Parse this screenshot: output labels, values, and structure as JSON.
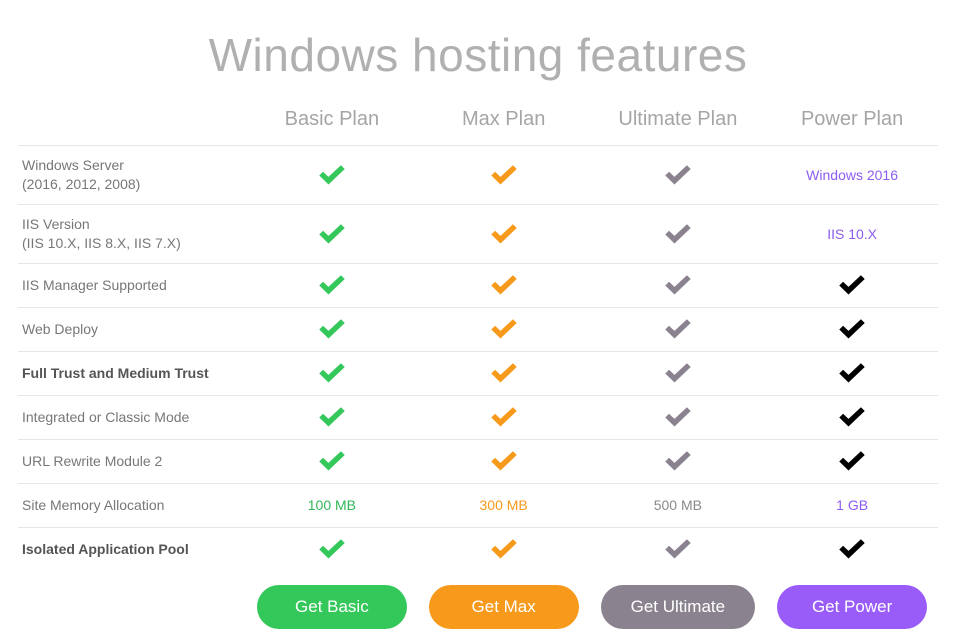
{
  "title": "Windows hosting features",
  "plans": [
    {
      "key": "basic",
      "title": "Basic Plan",
      "button": "Get Basic",
      "style": "green"
    },
    {
      "key": "max",
      "title": "Max Plan",
      "button": "Get Max",
      "style": "orange"
    },
    {
      "key": "ultimate",
      "title": "Ultimate Plan",
      "button": "Get Ultimate",
      "style": "grey"
    },
    {
      "key": "power",
      "title": "Power Plan",
      "button": "Get Power",
      "style": "purple"
    }
  ],
  "features": [
    {
      "label": "Windows Server\n(2016, 2012, 2008)",
      "bold": false,
      "cells": [
        {
          "type": "check"
        },
        {
          "type": "check"
        },
        {
          "type": "check"
        },
        {
          "type": "text",
          "value": "Windows 2016",
          "colorClass": "c-purple"
        }
      ]
    },
    {
      "label": "IIS Version\n(IIS 10.X, IIS 8.X, IIS 7.X)",
      "bold": false,
      "cells": [
        {
          "type": "check"
        },
        {
          "type": "check"
        },
        {
          "type": "check"
        },
        {
          "type": "text",
          "value": "IIS 10.X",
          "colorClass": "c-purple"
        }
      ]
    },
    {
      "label": "IIS Manager Supported",
      "bold": false,
      "cells": [
        {
          "type": "check"
        },
        {
          "type": "check"
        },
        {
          "type": "check"
        },
        {
          "type": "check"
        }
      ]
    },
    {
      "label": "Web Deploy",
      "bold": false,
      "cells": [
        {
          "type": "check"
        },
        {
          "type": "check"
        },
        {
          "type": "check"
        },
        {
          "type": "check"
        }
      ]
    },
    {
      "label": "Full Trust and Medium Trust",
      "bold": true,
      "cells": [
        {
          "type": "check"
        },
        {
          "type": "check"
        },
        {
          "type": "check"
        },
        {
          "type": "check"
        }
      ]
    },
    {
      "label": "Integrated or Classic Mode",
      "bold": false,
      "cells": [
        {
          "type": "check"
        },
        {
          "type": "check"
        },
        {
          "type": "check"
        },
        {
          "type": "check"
        }
      ]
    },
    {
      "label": "URL Rewrite Module 2",
      "bold": false,
      "cells": [
        {
          "type": "check"
        },
        {
          "type": "check"
        },
        {
          "type": "check"
        },
        {
          "type": "check"
        }
      ]
    },
    {
      "label": "Site Memory Allocation",
      "bold": false,
      "cells": [
        {
          "type": "text",
          "value": "100 MB",
          "colorClass": "c-green"
        },
        {
          "type": "text",
          "value": "300 MB",
          "colorClass": "c-orange"
        },
        {
          "type": "text",
          "value": "500 MB",
          "colorClass": "c-grey"
        },
        {
          "type": "text",
          "value": "1 GB",
          "colorClass": "c-purple"
        }
      ]
    },
    {
      "label": "Isolated Application Pool",
      "bold": true,
      "cells": [
        {
          "type": "check"
        },
        {
          "type": "check"
        },
        {
          "type": "check"
        },
        {
          "type": "check"
        }
      ]
    }
  ]
}
